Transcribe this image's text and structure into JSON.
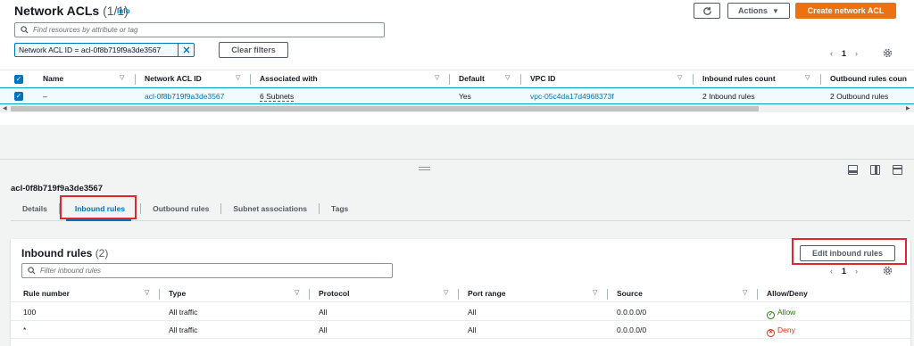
{
  "header": {
    "title": "Network ACLs",
    "count": "(1/1)",
    "info": "Info",
    "refresh_icon": "refresh-icon",
    "actions_label": "Actions",
    "create_label": "Create network ACL"
  },
  "search": {
    "placeholder": "Find resources by attribute or tag"
  },
  "filter": {
    "token": "Network ACL ID = acl-0f8b719f9a3de3567",
    "clear_label": "Clear filters"
  },
  "pagination": {
    "page": "1"
  },
  "table": {
    "columns": [
      "Name",
      "Network ACL ID",
      "Associated with",
      "Default",
      "VPC ID",
      "Inbound rules count",
      "Outbound rules coun"
    ],
    "row": {
      "name": "–",
      "acl_id": "acl-0f8b719f9a3de3567",
      "associated": "6 Subnets",
      "default": "Yes",
      "vpc_id": "vpc-05c4da17d4968373f",
      "inbound_count": "2 Inbound rules",
      "outbound_count": "2 Outbound rules"
    }
  },
  "detail": {
    "title": "acl-0f8b719f9a3de3567",
    "tabs": [
      "Details",
      "Inbound rules",
      "Outbound rules",
      "Subnet associations",
      "Tags"
    ],
    "active_tab": "Inbound rules"
  },
  "inbound": {
    "title": "Inbound rules",
    "count": "(2)",
    "edit_label": "Edit inbound rules",
    "search_placeholder": "Filter inbound rules",
    "page": "1",
    "columns": [
      "Rule number",
      "Type",
      "Protocol",
      "Port range",
      "Source",
      "Allow/Deny"
    ],
    "rules": [
      {
        "number": "100",
        "type": "All traffic",
        "protocol": "All",
        "port": "All",
        "source": "0.0.0.0/0",
        "action": "Allow"
      },
      {
        "number": "*",
        "type": "All traffic",
        "protocol": "All",
        "port": "All",
        "source": "0.0.0.0/0",
        "action": "Deny"
      }
    ]
  },
  "colors": {
    "accent": "#0073bb",
    "primary_button": "#ec7211",
    "highlight": "#e3262b",
    "allow": "#1d8102",
    "deny": "#d13212"
  }
}
